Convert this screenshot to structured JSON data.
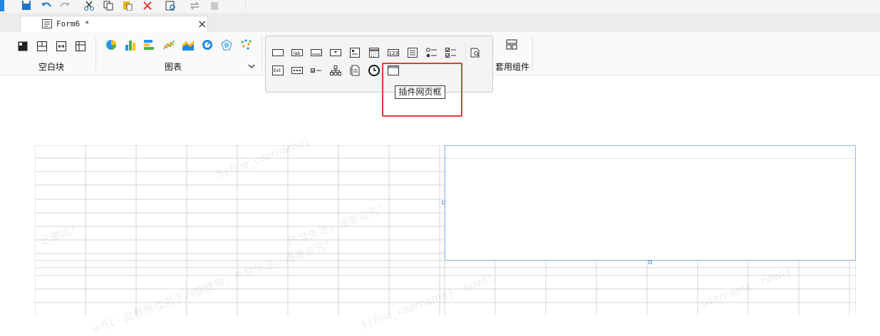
{
  "tab": {
    "title": "Form6 *",
    "close": "×"
  },
  "ribbon": {
    "blank_block_label": "空白块",
    "chart_label": "图表",
    "template_label": "套用组件"
  },
  "palette": {
    "tooltip": "插件网页框",
    "icons": [
      "text-field",
      "label",
      "button",
      "combo-box",
      "date-picker",
      "calendar",
      "number-field",
      "textarea",
      "radio-group",
      "checkbox-group",
      "report-preview",
      "ext-widget",
      "password-field",
      "checkbox",
      "tree",
      "file-upload",
      "time-picker",
      "iframe-widget"
    ]
  },
  "watermarks": [
    "${fine_username}",
    "已激活！",
    "严禁外泄，违者必究！",
    "w01 · 此数据仅用于内部使用，严禁外泄，违者必究！",
    "username · now()",
    "${fine_username} · now()"
  ],
  "colors": {
    "accent": "#1e88e5",
    "highlight": "#e53935",
    "selection": "#8fb8ef"
  }
}
